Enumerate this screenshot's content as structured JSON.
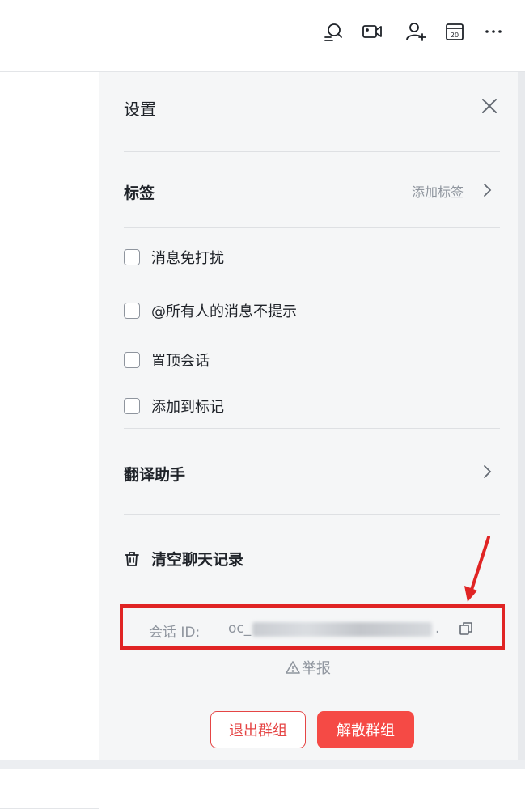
{
  "toolbar": {
    "icons": [
      "search-chat-icon",
      "video-call-icon",
      "add-member-icon",
      "calendar-icon",
      "more-icon"
    ],
    "calendar_day": "20"
  },
  "settings": {
    "title": "设置",
    "tag_section": {
      "title": "标签",
      "action_label": "添加标签"
    },
    "options": [
      {
        "label": "消息免打扰",
        "checked": false
      },
      {
        "label": "@所有人的消息不提示",
        "checked": false
      },
      {
        "label": "置顶会话",
        "checked": false
      },
      {
        "label": "添加到标记",
        "checked": false
      }
    ],
    "translate_title": "翻译助手",
    "clear_history_label": "清空聊天记录",
    "session_id": {
      "label": "会话 ID:",
      "value_prefix": "oc_",
      "value_suffix": "."
    },
    "report_label": "举报",
    "exit_group_label": "退出群组",
    "dissolve_group_label": "解散群组"
  },
  "colors": {
    "accent_red": "#f54a45",
    "highlight_box": "#e02424",
    "muted_text": "#8f959e"
  }
}
